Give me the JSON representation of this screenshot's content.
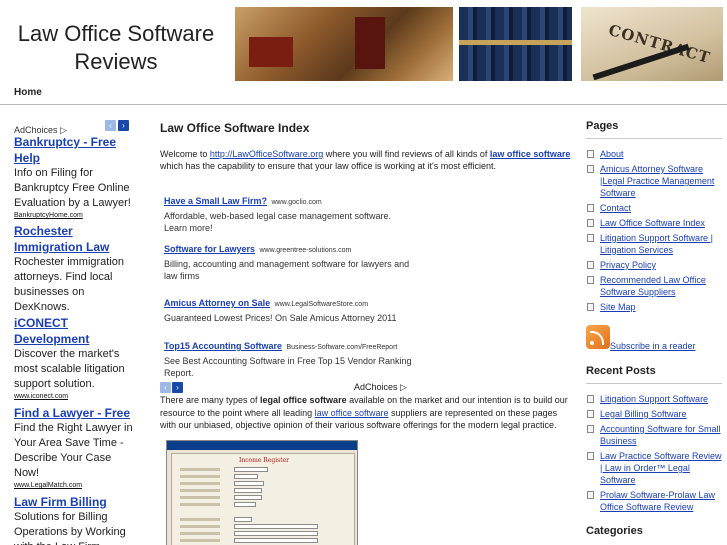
{
  "header": {
    "title_line1": "Law Office Software",
    "title_line2": "Reviews",
    "image_text": "CONTRACT"
  },
  "nav": {
    "home": "Home"
  },
  "left_ads": {
    "adchoices": "AdChoices ▷",
    "prev": "‹",
    "next": "›",
    "ads": [
      {
        "title": "Bankruptcy - Free Help",
        "desc": "Info on Filing for Bankruptcy Free Online Evaluation by a Lawyer!",
        "url": "BankruptcyHome.com"
      },
      {
        "title": "Rochester Immigration Law",
        "desc": "Rochester immigration attorneys. Find local businesses on DexKnows.",
        "url": ""
      },
      {
        "title": "iCONECT Development",
        "desc": "Discover the market's most scalable litigation support solution.",
        "url": "www.iconect.com"
      },
      {
        "title": "Find a Lawyer - Free",
        "desc": "Find the Right Lawyer in Your Area Save Time - Describe Your Case Now!",
        "url": "www.LegalMatch.com"
      },
      {
        "title": "Law Firm Billing",
        "desc": "Solutions for Billing Operations by Working with the Law Firm Experts",
        "url": ""
      }
    ]
  },
  "main": {
    "heading": "Law Office Software Index",
    "intro_prefix": "Welcome to ",
    "intro_link": "http://LawOfficeSoftware.org",
    "intro_mid": " where you will find reviews of all kinds of ",
    "intro_bold_link": "law office software",
    "intro_suffix": " which has the capability to ensure that your law office is working at it's most efficient.",
    "inline_ads": [
      {
        "title": "Have a Small Law Firm?",
        "url": "www.goclio.com",
        "desc": "Affordable, web-based legal case management software. Learn more!"
      },
      {
        "title": "Software for Lawyers",
        "url": "www.greentree-solutions.com",
        "desc": "Billing, accounting and management software for lawyers and law firms"
      },
      {
        "title": "Amicus Attorney on Sale",
        "url": "www.LegalSoftwareStore.com",
        "desc": "Guaranteed Lowest Prices! On Sale Amicus Attorney 2011"
      },
      {
        "title": "Top15 Accounting Software",
        "url": "Business-Software.com/FreeReport",
        "desc": "See Best Accounting Software in Free Top 15 Vendor Ranking Report."
      }
    ],
    "adchoices": "AdChoices ▷",
    "para_prefix": "There are many types of ",
    "para_bold": "legal office software",
    "para_mid": " available on the market and our intention is to build our resource to the point where all leading ",
    "para_link": "law office software",
    "para_suffix": " suppliers are represented on these pages with our unbiased, objective opinion of their various software offerings for the modern legal practice.",
    "screenshot_title": "Income Register"
  },
  "sidebar": {
    "pages_heading": "Pages",
    "pages": [
      "About",
      "Amicus Attorney Software |Legal Practice Management Software",
      "Contact",
      "Law Office Software Index",
      "Litigation Support Software | Litigation Services",
      "Privacy Policy",
      "Recommended Law Office Software Suppliers",
      "Site Map"
    ],
    "rss_label": "Subscribe in a reader",
    "recent_heading": "Recent Posts",
    "recent": [
      "Litigation Support Software",
      "Legal Billing Software",
      "Accounting Software for Small Business",
      "Law Practice Software Review | Law in Order™ Legal Software",
      "Prolaw Software-Prolaw Law Office Software Review"
    ],
    "categories_heading": "Categories"
  }
}
